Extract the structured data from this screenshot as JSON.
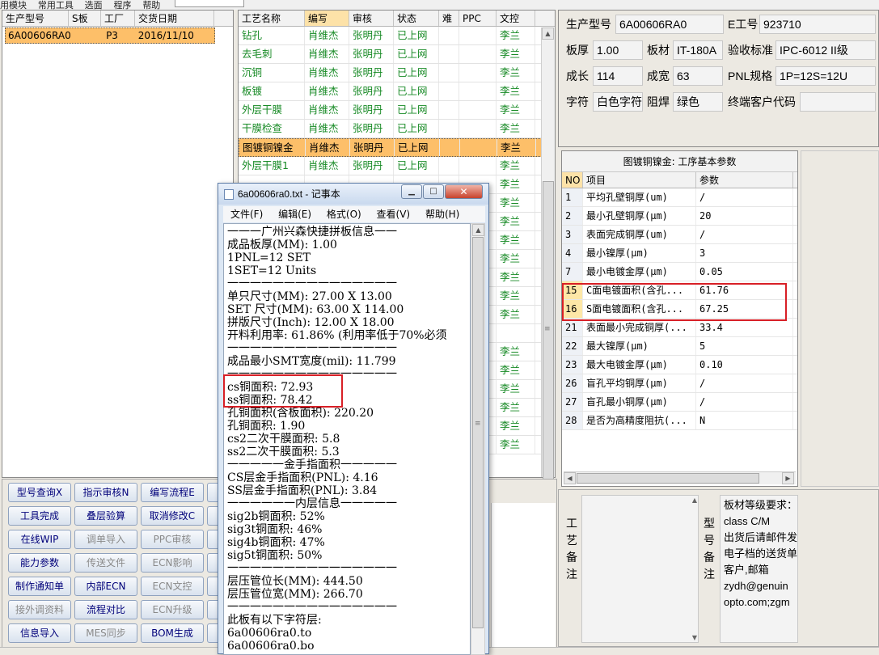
{
  "menubar": {
    "items": [
      "用模块",
      "常用工具",
      "选面",
      "程序",
      "帮助"
    ]
  },
  "orders": {
    "columns": [
      "生产型号",
      "S板",
      "工厂",
      "交货日期"
    ],
    "rows": [
      {
        "model": "6A00606RA0",
        "s": "",
        "factory": "P3",
        "date": "2016/11/10"
      }
    ]
  },
  "process": {
    "columns": [
      "工艺名称",
      "编写",
      "审核",
      "状态",
      "难",
      "PPC",
      "文控"
    ],
    "rows": [
      {
        "name": "钻孔",
        "writer": "肖维杰",
        "reviewer": "张明丹",
        "status": "已上网",
        "hard": "",
        "ppc": "",
        "control": "李兰"
      },
      {
        "name": "去毛刺",
        "writer": "肖维杰",
        "reviewer": "张明丹",
        "status": "已上网",
        "hard": "",
        "ppc": "",
        "control": "李兰"
      },
      {
        "name": "沉铜",
        "writer": "肖维杰",
        "reviewer": "张明丹",
        "status": "已上网",
        "hard": "",
        "ppc": "",
        "control": "李兰"
      },
      {
        "name": "板镀",
        "writer": "肖维杰",
        "reviewer": "张明丹",
        "status": "已上网",
        "hard": "",
        "ppc": "",
        "control": "李兰"
      },
      {
        "name": "外层干膜",
        "writer": "肖维杰",
        "reviewer": "张明丹",
        "status": "已上网",
        "hard": "",
        "ppc": "",
        "control": "李兰"
      },
      {
        "name": "干膜检查",
        "writer": "肖维杰",
        "reviewer": "张明丹",
        "status": "已上网",
        "hard": "",
        "ppc": "",
        "control": "李兰"
      },
      {
        "name": "图镀铜镍金",
        "writer": "肖维杰",
        "reviewer": "张明丹",
        "status": "已上网",
        "hard": "",
        "ppc": "",
        "control": "李兰",
        "selected": true
      },
      {
        "name": "外层干膜1",
        "writer": "肖维杰",
        "reviewer": "张明丹",
        "status": "已上网",
        "hard": "",
        "ppc": "",
        "control": "李兰"
      },
      {
        "name": "",
        "writer": "",
        "reviewer": "",
        "status": "",
        "hard": "",
        "ppc": "",
        "control": "李兰"
      },
      {
        "name": "",
        "writer": "",
        "reviewer": "",
        "status": "",
        "hard": "",
        "ppc": "",
        "control": "李兰"
      },
      {
        "name": "",
        "writer": "",
        "reviewer": "",
        "status": "",
        "hard": "",
        "ppc": "",
        "control": "李兰"
      },
      {
        "name": "",
        "writer": "",
        "reviewer": "",
        "status": "",
        "hard": "",
        "ppc": "",
        "control": "李兰"
      },
      {
        "name": "",
        "writer": "",
        "reviewer": "",
        "status": "",
        "hard": "",
        "ppc": "",
        "control": "李兰"
      },
      {
        "name": "",
        "writer": "",
        "reviewer": "",
        "status": "",
        "hard": "",
        "ppc": "",
        "control": "李兰"
      },
      {
        "name": "",
        "writer": "",
        "reviewer": "",
        "status": "",
        "hard": "",
        "ppc": "",
        "control": "李兰"
      },
      {
        "name": "",
        "writer": "",
        "reviewer": "",
        "status": "",
        "hard": "",
        "ppc": "",
        "control": "李兰"
      },
      {
        "name": "",
        "writer": "",
        "reviewer": "",
        "status": "",
        "hard": "",
        "ppc": "",
        "control": ""
      },
      {
        "name": "",
        "writer": "",
        "reviewer": "",
        "status": "",
        "hard": "",
        "ppc": "",
        "control": "李兰"
      },
      {
        "name": "",
        "writer": "",
        "reviewer": "",
        "status": "",
        "hard": "",
        "ppc": "",
        "control": "李兰"
      },
      {
        "name": "",
        "writer": "",
        "reviewer": "",
        "status": "",
        "hard": "",
        "ppc": "",
        "control": "李兰"
      },
      {
        "name": "",
        "writer": "",
        "reviewer": "",
        "status": "",
        "hard": "",
        "ppc": "",
        "control": "李兰"
      },
      {
        "name": "",
        "writer": "",
        "reviewer": "",
        "status": "",
        "hard": "",
        "ppc": "",
        "control": "李兰"
      },
      {
        "name": "",
        "writer": "",
        "reviewer": "",
        "status": "",
        "hard": "",
        "ppc": "",
        "control": "李兰"
      }
    ]
  },
  "buttons": [
    {
      "label": "型号查询X",
      "state": "active"
    },
    {
      "label": "指示审核N",
      "state": "active"
    },
    {
      "label": "编写流程E",
      "state": "active"
    },
    {
      "label": "工具完成",
      "state": "active"
    },
    {
      "label": "叠层验算",
      "state": "active"
    },
    {
      "label": "取消修改C",
      "state": "active"
    },
    {
      "label": "在线WIP",
      "state": "active"
    },
    {
      "label": "调单导入",
      "state": "disabled"
    },
    {
      "label": "PPC审核",
      "state": "disabled"
    },
    {
      "label": "能力参数",
      "state": "active"
    },
    {
      "label": "传送文件",
      "state": "disabled"
    },
    {
      "label": "ECN影响",
      "state": "disabled"
    },
    {
      "label": "制作通知单",
      "state": "active"
    },
    {
      "label": "内部ECN",
      "state": "active"
    },
    {
      "label": "ECN文控",
      "state": "disabled"
    },
    {
      "label": "接外调资料",
      "state": "disabled"
    },
    {
      "label": "流程对比",
      "state": "active"
    },
    {
      "label": "ECN升级",
      "state": "disabled"
    },
    {
      "label": "信息导入",
      "state": "active"
    },
    {
      "label": "MES同步",
      "state": "disabled"
    },
    {
      "label": "BOM生成",
      "state": "active"
    }
  ],
  "info": {
    "model_label": "生产型号",
    "model": "6A00606RA0",
    "eno_label": "E工号",
    "eno": "923710",
    "thick_label": "板厚",
    "thick": "1.00",
    "material_label": "板材",
    "material": "IT-180A",
    "std_label": "验收标准",
    "std": "IPC-6012 II级",
    "len_label": "成长",
    "len": "114",
    "width_label": "成宽",
    "width": "63",
    "pnl_label": "PNL规格",
    "pnl": "1P=12S=12U",
    "char_label": "字符",
    "char": "白色字符",
    "mask_label": "阻焊",
    "mask": "绿色",
    "cust_label": "终端客户代码",
    "cust": ""
  },
  "params": {
    "title": "图镀铜镍金: 工序基本参数",
    "columns": [
      "NO",
      "项目",
      "参数"
    ],
    "rows": [
      {
        "no": "1",
        "item": "平均孔壁铜厚(um)",
        "value": "/"
      },
      {
        "no": "2",
        "item": "最小孔壁铜厚(μm)",
        "value": "20"
      },
      {
        "no": "3",
        "item": "表面完成铜厚(um)",
        "value": "/"
      },
      {
        "no": "4",
        "item": "最小镍厚(μm)",
        "value": "3"
      },
      {
        "no": "7",
        "item": "最小电镀金厚(μm)",
        "value": "0.05"
      },
      {
        "no": "15",
        "item": "C面电镀面积(含孔...",
        "value": "61.76"
      },
      {
        "no": "16",
        "item": "S面电镀面积(含孔...",
        "value": "67.25"
      },
      {
        "no": "21",
        "item": "表面最小完成铜厚(...",
        "value": "33.4"
      },
      {
        "no": "22",
        "item": "最大镍厚(μm)",
        "value": "5"
      },
      {
        "no": "23",
        "item": "最大电镀金厚(μm)",
        "value": "0.10"
      },
      {
        "no": "26",
        "item": "盲孔平均铜厚(μm)",
        "value": "/"
      },
      {
        "no": "27",
        "item": "盲孔最小铜厚(μm)",
        "value": "/"
      },
      {
        "no": "28",
        "item": "是否为高精度阻抗(...",
        "value": "N"
      }
    ]
  },
  "notes": {
    "process_label": [
      "工",
      "艺",
      "备",
      "注"
    ],
    "model_label": [
      "型",
      "号",
      "备",
      "注"
    ],
    "remark_lines": [
      "板材等级要求：",
      "class C/M",
      "出货后请邮件发",
      "电子档的送货单",
      "客户,邮箱",
      "zydh@genuin",
      "opto.com;zgm"
    ]
  },
  "notepad": {
    "title": "6a00606ra0.txt - 记事本",
    "menu": [
      "文件(F)",
      "编辑(E)",
      "格式(O)",
      "查看(V)",
      "帮助(H)"
    ],
    "lines": [
      "一一一广州兴森快捷拼板信息一一",
      "成品板厚(MM): 1.00",
      "1PNL=12 SET",
      "1SET=12 Units",
      "一一一一一一一一一一一一一一一",
      "单只尺寸(MM): 27.00 X 13.00",
      "SET 尺寸(MM): 63.00 X 114.00",
      "拼版尺寸(Inch): 12.00 X 18.00",
      "开料利用率: 61.86% (利用率低于70%必须",
      "一一一一一一一一一一一一一一一",
      "成品最小SMT宽度(mil): 11.799",
      "一一一一一一一一一一一一一一一",
      "cs铜面积: 72.93",
      "ss铜面积: 78.42",
      "孔铜面积(含板面积): 220.20",
      "孔铜面积: 1.90",
      "cs2二次干膜面积: 5.8",
      "ss2二次干膜面积: 5.3",
      "一一一一一金手指面积一一一一一",
      "CS层金手指面积(PNL): 4.16",
      "SS层金手指面积(PNL): 3.84",
      "一一一一一一内层信息一一一一一",
      "sig2b铜面积: 52%",
      "sig3t铜面积: 46%",
      "sig4b铜面积: 47%",
      "sig5t铜面积: 50%",
      "一一一一一一一一一一一一一一一",
      "层压管位长(MM): 444.50",
      "层压管位宽(MM): 266.70",
      "一一一一一一一一一一一一一一一",
      "此板有以下字符层:",
      "6a00606ra0.to",
      "6a00606ra0.bo"
    ]
  },
  "colors": {
    "selected_row": "#fdbf69",
    "status_green": "#178a25",
    "highlight_red": "#d81f26"
  }
}
